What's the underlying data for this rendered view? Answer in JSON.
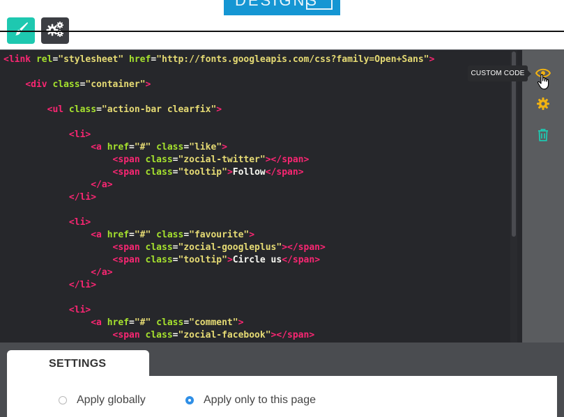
{
  "header": {
    "logo_text": "DESIGNS",
    "style_button_icon": "paint-brush-icon",
    "settings_button_icon": "gears-icon"
  },
  "code_editor": {
    "lines": [
      "<link rel=\"stylesheet\" href=\"http://fonts.googleapis.com/css?family=Open+Sans\">",
      "",
      "    <div class=\"container\">",
      "",
      "        <ul class=\"action-bar clearfix\">",
      "",
      "            <li>",
      "                <a href=\"#\" class=\"like\">",
      "                    <span class=\"zocial-twitter\"></span>",
      "                    <span class=\"tooltip\">Follow</span>",
      "                </a>",
      "            </li>",
      "",
      "            <li>",
      "                <a href=\"#\" class=\"favourite\">",
      "                    <span class=\"zocial-googleplus\"></span>",
      "                    <span class=\"tooltip\">Circle us</span>",
      "                </a>",
      "            </li>",
      "",
      "            <li>",
      "                <a href=\"#\" class=\"comment\">",
      "                    <span class=\"zocial-facebook\"></span>"
    ]
  },
  "side_panel": {
    "tooltip": "CUSTOM CODE",
    "icons": [
      "eye-icon",
      "gear-icon",
      "trash-icon"
    ]
  },
  "settings": {
    "tab_label": "SETTINGS",
    "options": [
      {
        "label": "Apply globally",
        "selected": false
      },
      {
        "label": "Apply only to this page",
        "selected": true
      }
    ]
  },
  "colors": {
    "accent": "#1ec8b0",
    "logo_bg": "#1596d3",
    "editor_bg": "#26272b",
    "icon_yellow": "#f2b311",
    "tag_pink": "#f92672",
    "attr_green": "#a6e22e",
    "string_yellow": "#e6db74",
    "radio_blue": "#2f8fe6"
  }
}
